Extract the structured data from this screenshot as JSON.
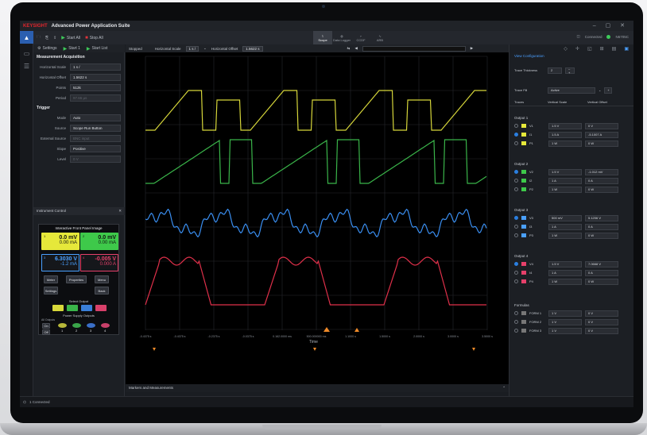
{
  "window": {
    "title": "Advanced Power Application Suite",
    "logo": "KEYSIGHT",
    "controls": "– ▢ ✕"
  },
  "toolbar": {
    "run_all": "Start All",
    "stop_all": "Stop All",
    "modes": [
      {
        "label": "Scope"
      },
      {
        "label": "Data Logger"
      },
      {
        "label": "CCDF"
      },
      {
        "label": "ARB"
      }
    ],
    "connection": "Connected",
    "instrument": "N6705C"
  },
  "subbar": {
    "settings": "Settings",
    "start1": "Start 1",
    "start_list": "Start List"
  },
  "acquisition": {
    "title": "Measurement Acquisition",
    "fields": [
      {
        "label": "Horizontal Scale",
        "value": "1 s /"
      },
      {
        "label": "Horizontal Offset",
        "value": "1.5622 s"
      },
      {
        "label": "Points",
        "value": "512k"
      },
      {
        "label": "Period",
        "value": "97.65 µs"
      }
    ],
    "trigger_title": "Trigger",
    "trigger_fields": [
      {
        "label": "Mode",
        "value": "Auto"
      },
      {
        "label": "Source",
        "value": "Scope Run Button"
      },
      {
        "label": "External Source",
        "value": "BNC input"
      },
      {
        "label": "Slope",
        "value": "Positive"
      },
      {
        "label": "Level",
        "value": "0 V"
      }
    ]
  },
  "instrument_control": {
    "title": "Instrument Control",
    "fpi_title": "Interactive Front Panel Image",
    "channels": [
      {
        "n": "1",
        "v": "0.0 mV",
        "a": "0.00 mA",
        "color": "#e6e83a"
      },
      {
        "n": "2",
        "v": "0.0 mV",
        "a": "0.00 mA",
        "color": "#3ec94a"
      },
      {
        "n": "3",
        "v": "6.3030 V",
        "a": "-1.2 mA",
        "color": "#4aa0ff"
      },
      {
        "n": "4",
        "v": "-0.005 V",
        "a": "0.000 A",
        "color": "#e6406a"
      }
    ],
    "buttons": [
      "Meter",
      "Properties",
      "Menu",
      "Settings",
      "Back"
    ],
    "select_output": "Select Output",
    "power_outputs": "Power Supply Outputs",
    "all_outputs": "All Outputs",
    "on": "On",
    "off": "Off",
    "outputs": [
      "1",
      "2",
      "3",
      "4"
    ]
  },
  "scope": {
    "state": "Stopped",
    "hscale_label": "Horizontal Scale",
    "hscale": "1 s /",
    "hoffset_label": "Horizontal Offset",
    "hoffset": "1.5622 s",
    "x_axis_label": "Time",
    "x_ticks": [
      "-0.4375 s",
      "-0.4375 s",
      "-0.2375 s",
      "-0.0375 s",
      "0.162.0000 ms",
      "500.000000 ms",
      "1.1000 s",
      "1.5000 s",
      "2.0000 s",
      "3.0000 s",
      "3.5000 s"
    ],
    "markers_title": "Markers and Measurements"
  },
  "traces": {
    "title": "View Configuration",
    "thickness_label": "Trace Thickness",
    "thickness": "2",
    "fill_label": "Trace Fill",
    "fill": "Active",
    "headers": [
      "Traces",
      "Vertical Scale",
      "Vertical Offset"
    ],
    "groups": [
      {
        "name": "Output 1",
        "rows": [
          {
            "on": false,
            "color": "#e6e83a",
            "t": "V1",
            "s": "1.5 V",
            "o": "0 V"
          },
          {
            "on": true,
            "color": "#e6e83a",
            "t": "I1",
            "s": "1.5 A",
            "o": "-5.1007 A"
          },
          {
            "on": false,
            "color": "#e6e83a",
            "t": "P1",
            "s": "1 W",
            "o": "0 W"
          }
        ]
      },
      {
        "name": "Output 2",
        "rows": [
          {
            "on": true,
            "color": "#3ec94a",
            "t": "V2",
            "s": "1.5 V",
            "o": "-1.012 mV"
          },
          {
            "on": false,
            "color": "#3ec94a",
            "t": "I2",
            "s": "1 A",
            "o": "0 A"
          },
          {
            "on": false,
            "color": "#3ec94a",
            "t": "P2",
            "s": "1 W",
            "o": "0 W"
          }
        ]
      },
      {
        "name": "Output 3",
        "rows": [
          {
            "on": true,
            "color": "#4aa0ff",
            "t": "V3",
            "s": "500 mV",
            "o": "5.1206 V"
          },
          {
            "on": false,
            "color": "#4aa0ff",
            "t": "I3",
            "s": "1 A",
            "o": "0 A"
          },
          {
            "on": false,
            "color": "#4aa0ff",
            "t": "P3",
            "s": "1 W",
            "o": "0 W"
          }
        ]
      },
      {
        "name": "Output 4",
        "rows": [
          {
            "on": true,
            "color": "#e6406a",
            "t": "V4",
            "s": "1.5 V",
            "o": "7.0668 V"
          },
          {
            "on": false,
            "color": "#e6406a",
            "t": "I4",
            "s": "1 A",
            "o": "0 A"
          },
          {
            "on": false,
            "color": "#e6406a",
            "t": "P4",
            "s": "1 W",
            "o": "0 W"
          }
        ]
      }
    ],
    "formulas_title": "Formulas",
    "formulas": [
      {
        "t": "FORM 1",
        "s": "1 V",
        "o": "0 V"
      },
      {
        "t": "FORM 2",
        "s": "1 V",
        "o": "0 V"
      },
      {
        "t": "FORM 3",
        "s": "1 V",
        "o": "0 V"
      }
    ]
  },
  "status": {
    "text": "1 Connected"
  }
}
